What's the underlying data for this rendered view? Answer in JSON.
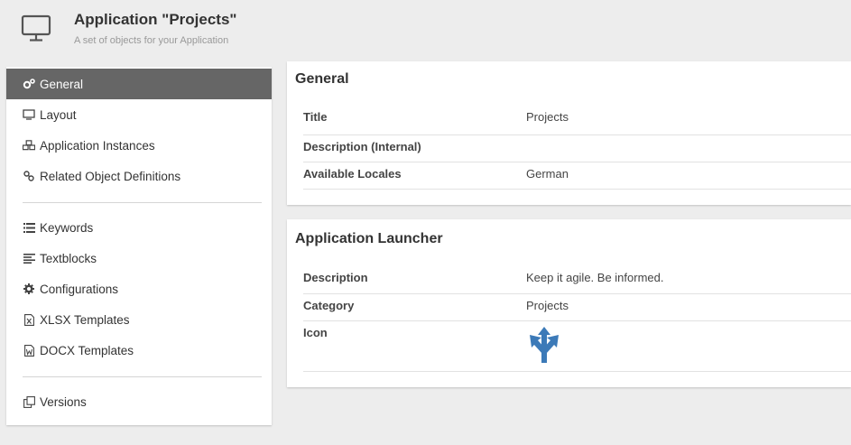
{
  "header": {
    "title": "Application \"Projects\"",
    "subtitle": "A set of objects for your Application",
    "icon": "monitor-icon"
  },
  "sidebar": {
    "group1": [
      {
        "label": "General",
        "icon": "cogs-icon",
        "active": true
      },
      {
        "label": "Layout",
        "icon": "monitor-icon"
      },
      {
        "label": "Application Instances",
        "icon": "cubes-icon"
      },
      {
        "label": "Related Object Definitions",
        "icon": "link-icon"
      }
    ],
    "group2": [
      {
        "label": "Keywords",
        "icon": "list-icon"
      },
      {
        "label": "Textblocks",
        "icon": "align-left-icon"
      },
      {
        "label": "Configurations",
        "icon": "gear-icon"
      },
      {
        "label": "XLSX Templates",
        "icon": "xlsx-file-icon"
      },
      {
        "label": "DOCX Templates",
        "icon": "docx-file-icon"
      }
    ],
    "group3": [
      {
        "label": "Versions",
        "icon": "copy-icon"
      }
    ]
  },
  "general": {
    "title": "General",
    "rows": [
      {
        "key": "Title",
        "value": "Projects"
      },
      {
        "key": "Description (Internal)",
        "value": ""
      },
      {
        "key": "Available Locales",
        "value": "German"
      }
    ]
  },
  "launcher": {
    "title": "Application Launcher",
    "rows": [
      {
        "key": "Description",
        "value": "Keep it agile. Be informed."
      },
      {
        "key": "Category",
        "value": "Projects"
      },
      {
        "key": "Icon",
        "value": ""
      }
    ],
    "icon_name": "split-arrows-icon",
    "icon_color": "#3c7ab8"
  },
  "colors": {
    "active_nav_bg": "#666666",
    "background": "#ededed",
    "accent": "#3c7ab8"
  }
}
